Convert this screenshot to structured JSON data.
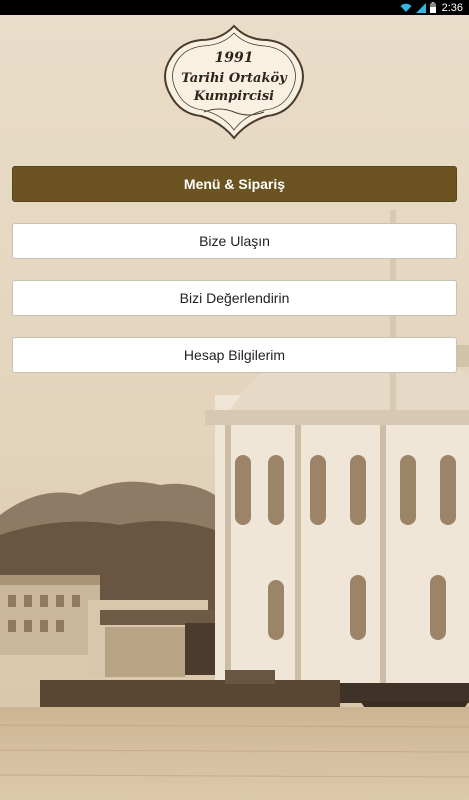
{
  "status_bar": {
    "time": "2:36",
    "icons": [
      "wifi-icon",
      "signal-icon",
      "battery-icon"
    ]
  },
  "logo": {
    "year": "1991",
    "line1": "Tarihi Ortaköy",
    "line2": "Kumpircisi"
  },
  "menu": {
    "primary_label": "Menü & Sipariş",
    "contact_label": "Bize Ulaşın",
    "rate_label": "Bizi Değerlendirin",
    "account_label": "Hesap Bilgilerim"
  },
  "colors": {
    "primary_button": "#6b5322",
    "secondary_button": "#ffffff",
    "background_sepia": "#e9ddc8"
  }
}
